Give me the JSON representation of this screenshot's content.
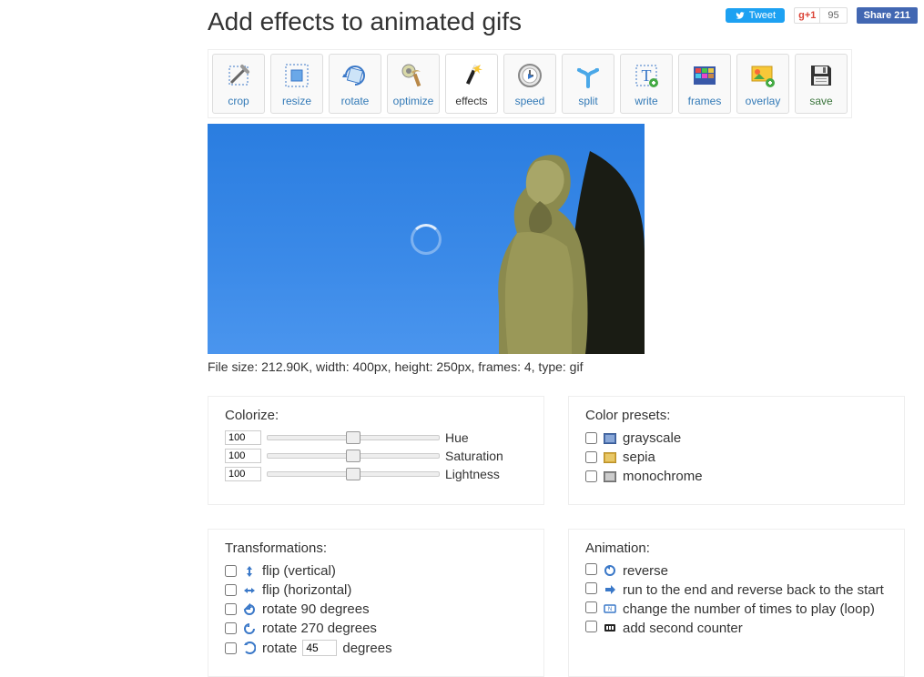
{
  "header": {
    "title": "Add effects to animated gifs"
  },
  "share": {
    "tweet": "Tweet",
    "gplus": "g+1",
    "gplus_count": "95",
    "fb": "Share 211"
  },
  "toolbar": [
    {
      "id": "crop",
      "label": "crop",
      "active": false
    },
    {
      "id": "resize",
      "label": "resize",
      "active": false
    },
    {
      "id": "rotate",
      "label": "rotate",
      "active": false
    },
    {
      "id": "optimize",
      "label": "optimize",
      "active": false
    },
    {
      "id": "effects",
      "label": "effects",
      "active": true
    },
    {
      "id": "speed",
      "label": "speed",
      "active": false
    },
    {
      "id": "split",
      "label": "split",
      "active": false
    },
    {
      "id": "write",
      "label": "write",
      "active": false
    },
    {
      "id": "frames",
      "label": "frames",
      "active": false
    },
    {
      "id": "overlay",
      "label": "overlay",
      "active": false
    },
    {
      "id": "save",
      "label": "save",
      "active": false
    }
  ],
  "fileinfo": "File size: 212.90K, width: 400px, height: 250px, frames: 4, type: gif",
  "colorize": {
    "title": "Colorize:",
    "hue": {
      "value": "100",
      "label": "Hue"
    },
    "sat": {
      "value": "100",
      "label": "Saturation"
    },
    "light": {
      "value": "100",
      "label": "Lightness"
    }
  },
  "presets": {
    "title": "Color presets:",
    "grayscale": "grayscale",
    "sepia": "sepia",
    "monochrome": "monochrome"
  },
  "transforms": {
    "title": "Transformations:",
    "flip_v": "flip (vertical)",
    "flip_h": "flip (horizontal)",
    "rot90": "rotate 90 degrees",
    "rot270": "rotate 270 degrees",
    "rot_custom_prefix": "rotate",
    "rot_custom_value": "45",
    "rot_custom_suffix": "degrees"
  },
  "animation": {
    "title": "Animation:",
    "reverse": "reverse",
    "boomerang": "run to the end and reverse back to the start",
    "loop": "change the number of times to play (loop)",
    "counter": "add second counter"
  }
}
